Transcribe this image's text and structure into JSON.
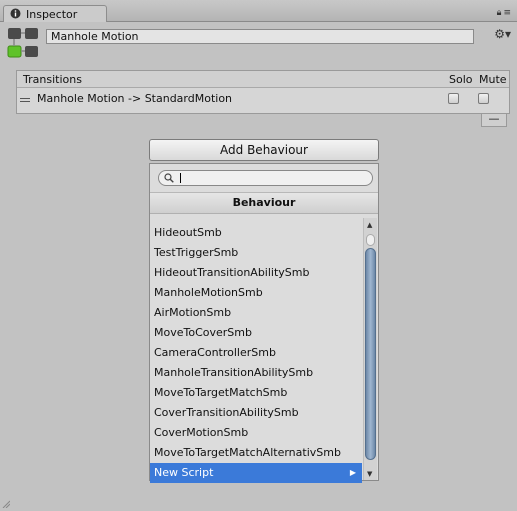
{
  "tab": {
    "label": "Inspector",
    "icon": "info-icon"
  },
  "toolbar_icons": [
    "lock-icon",
    "menu-icon"
  ],
  "header": {
    "name": "Manhole Motion",
    "icon": "state-machine-icon",
    "settings_icon": "gear-icon"
  },
  "transitions": {
    "title": "Transitions",
    "solo_label": "Solo",
    "mute_label": "Mute",
    "rows": [
      {
        "label": "Manhole Motion -> StandardMotion",
        "solo": false,
        "mute": false
      }
    ],
    "remove_label": "—"
  },
  "add_behaviour_label": "Add Behaviour",
  "popup": {
    "search_value": "",
    "title": "Behaviour",
    "items": [
      "HideoutSmb",
      "TestTriggerSmb",
      "HideoutTransitionAbilitySmb",
      "ManholeMotionSmb",
      "AirMotionSmb",
      "MoveToCoverSmb",
      "CameraControllerSmb",
      "ManholeTransitionAbilitySmb",
      "MoveToTargetMatchSmb",
      "CoverTransitionAbilitySmb",
      "CoverMotionSmb",
      "MoveToTargetMatchAlternativSmb",
      "New Script"
    ],
    "selected_item": "New Script"
  },
  "colors": {
    "selection": "#3b7ad9",
    "background": "#c2c2c2",
    "scroll_thumb": "#8aa2bf"
  }
}
